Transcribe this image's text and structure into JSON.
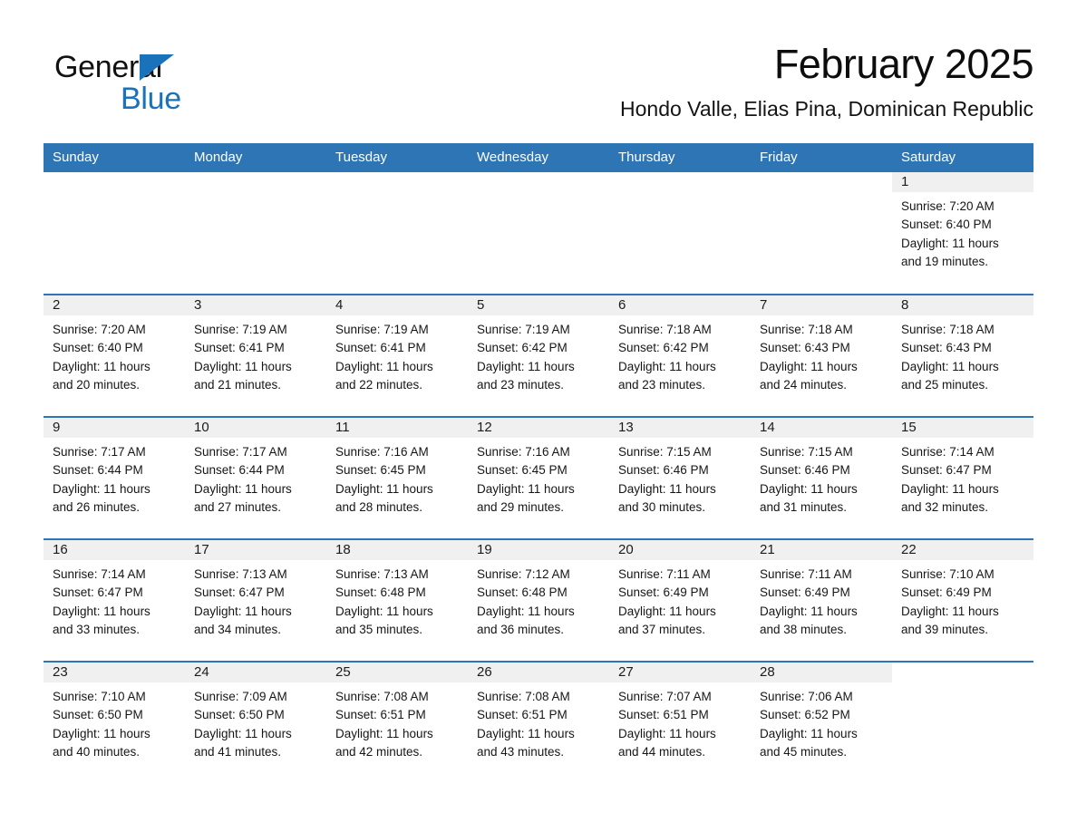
{
  "brand": {
    "name_dark": "General",
    "name_blue": "Blue",
    "triangle_icon": "blue-triangle-logo-mark",
    "accent_color": "#1a72bb"
  },
  "header": {
    "month_title": "February 2025",
    "location": "Hondo Valle, Elias Pina, Dominican Republic"
  },
  "calendar": {
    "header_bg": "#2e75b6",
    "daynum_band_bg": "#f0f0f0",
    "row_rule_color": "#2e75b6",
    "weekday_headers": [
      "Sunday",
      "Monday",
      "Tuesday",
      "Wednesday",
      "Thursday",
      "Friday",
      "Saturday"
    ],
    "weeks": [
      [
        {
          "date": "",
          "lines": []
        },
        {
          "date": "",
          "lines": []
        },
        {
          "date": "",
          "lines": []
        },
        {
          "date": "",
          "lines": []
        },
        {
          "date": "",
          "lines": []
        },
        {
          "date": "",
          "lines": []
        },
        {
          "date": "1",
          "lines": [
            "Sunrise: 7:20 AM",
            "Sunset: 6:40 PM",
            "Daylight: 11 hours",
            "and 19 minutes."
          ]
        }
      ],
      [
        {
          "date": "2",
          "lines": [
            "Sunrise: 7:20 AM",
            "Sunset: 6:40 PM",
            "Daylight: 11 hours",
            "and 20 minutes."
          ]
        },
        {
          "date": "3",
          "lines": [
            "Sunrise: 7:19 AM",
            "Sunset: 6:41 PM",
            "Daylight: 11 hours",
            "and 21 minutes."
          ]
        },
        {
          "date": "4",
          "lines": [
            "Sunrise: 7:19 AM",
            "Sunset: 6:41 PM",
            "Daylight: 11 hours",
            "and 22 minutes."
          ]
        },
        {
          "date": "5",
          "lines": [
            "Sunrise: 7:19 AM",
            "Sunset: 6:42 PM",
            "Daylight: 11 hours",
            "and 23 minutes."
          ]
        },
        {
          "date": "6",
          "lines": [
            "Sunrise: 7:18 AM",
            "Sunset: 6:42 PM",
            "Daylight: 11 hours",
            "and 23 minutes."
          ]
        },
        {
          "date": "7",
          "lines": [
            "Sunrise: 7:18 AM",
            "Sunset: 6:43 PM",
            "Daylight: 11 hours",
            "and 24 minutes."
          ]
        },
        {
          "date": "8",
          "lines": [
            "Sunrise: 7:18 AM",
            "Sunset: 6:43 PM",
            "Daylight: 11 hours",
            "and 25 minutes."
          ]
        }
      ],
      [
        {
          "date": "9",
          "lines": [
            "Sunrise: 7:17 AM",
            "Sunset: 6:44 PM",
            "Daylight: 11 hours",
            "and 26 minutes."
          ]
        },
        {
          "date": "10",
          "lines": [
            "Sunrise: 7:17 AM",
            "Sunset: 6:44 PM",
            "Daylight: 11 hours",
            "and 27 minutes."
          ]
        },
        {
          "date": "11",
          "lines": [
            "Sunrise: 7:16 AM",
            "Sunset: 6:45 PM",
            "Daylight: 11 hours",
            "and 28 minutes."
          ]
        },
        {
          "date": "12",
          "lines": [
            "Sunrise: 7:16 AM",
            "Sunset: 6:45 PM",
            "Daylight: 11 hours",
            "and 29 minutes."
          ]
        },
        {
          "date": "13",
          "lines": [
            "Sunrise: 7:15 AM",
            "Sunset: 6:46 PM",
            "Daylight: 11 hours",
            "and 30 minutes."
          ]
        },
        {
          "date": "14",
          "lines": [
            "Sunrise: 7:15 AM",
            "Sunset: 6:46 PM",
            "Daylight: 11 hours",
            "and 31 minutes."
          ]
        },
        {
          "date": "15",
          "lines": [
            "Sunrise: 7:14 AM",
            "Sunset: 6:47 PM",
            "Daylight: 11 hours",
            "and 32 minutes."
          ]
        }
      ],
      [
        {
          "date": "16",
          "lines": [
            "Sunrise: 7:14 AM",
            "Sunset: 6:47 PM",
            "Daylight: 11 hours",
            "and 33 minutes."
          ]
        },
        {
          "date": "17",
          "lines": [
            "Sunrise: 7:13 AM",
            "Sunset: 6:47 PM",
            "Daylight: 11 hours",
            "and 34 minutes."
          ]
        },
        {
          "date": "18",
          "lines": [
            "Sunrise: 7:13 AM",
            "Sunset: 6:48 PM",
            "Daylight: 11 hours",
            "and 35 minutes."
          ]
        },
        {
          "date": "19",
          "lines": [
            "Sunrise: 7:12 AM",
            "Sunset: 6:48 PM",
            "Daylight: 11 hours",
            "and 36 minutes."
          ]
        },
        {
          "date": "20",
          "lines": [
            "Sunrise: 7:11 AM",
            "Sunset: 6:49 PM",
            "Daylight: 11 hours",
            "and 37 minutes."
          ]
        },
        {
          "date": "21",
          "lines": [
            "Sunrise: 7:11 AM",
            "Sunset: 6:49 PM",
            "Daylight: 11 hours",
            "and 38 minutes."
          ]
        },
        {
          "date": "22",
          "lines": [
            "Sunrise: 7:10 AM",
            "Sunset: 6:49 PM",
            "Daylight: 11 hours",
            "and 39 minutes."
          ]
        }
      ],
      [
        {
          "date": "23",
          "lines": [
            "Sunrise: 7:10 AM",
            "Sunset: 6:50 PM",
            "Daylight: 11 hours",
            "and 40 minutes."
          ]
        },
        {
          "date": "24",
          "lines": [
            "Sunrise: 7:09 AM",
            "Sunset: 6:50 PM",
            "Daylight: 11 hours",
            "and 41 minutes."
          ]
        },
        {
          "date": "25",
          "lines": [
            "Sunrise: 7:08 AM",
            "Sunset: 6:51 PM",
            "Daylight: 11 hours",
            "and 42 minutes."
          ]
        },
        {
          "date": "26",
          "lines": [
            "Sunrise: 7:08 AM",
            "Sunset: 6:51 PM",
            "Daylight: 11 hours",
            "and 43 minutes."
          ]
        },
        {
          "date": "27",
          "lines": [
            "Sunrise: 7:07 AM",
            "Sunset: 6:51 PM",
            "Daylight: 11 hours",
            "and 44 minutes."
          ]
        },
        {
          "date": "28",
          "lines": [
            "Sunrise: 7:06 AM",
            "Sunset: 6:52 PM",
            "Daylight: 11 hours",
            "and 45 minutes."
          ]
        },
        {
          "date": "",
          "lines": []
        }
      ]
    ]
  }
}
